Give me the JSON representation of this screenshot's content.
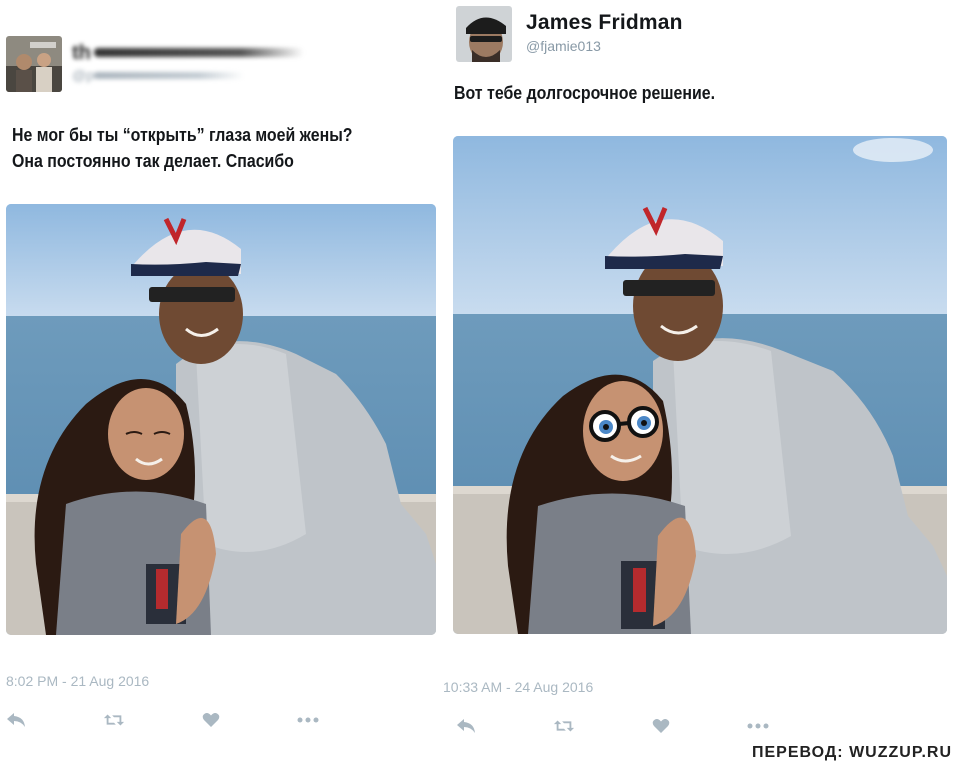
{
  "left_tweet": {
    "author_name": "th",
    "author_handle": "@p",
    "text_line_1": "Не мог бы ты “открыть” глаза моей жены?",
    "text_line_2": "Она постоянно так делает. Спасибо",
    "timestamp": "8:02 PM - 21 Aug 2016",
    "actions": [
      "reply-icon",
      "retweet-icon",
      "like-icon",
      "more-icon"
    ]
  },
  "right_tweet": {
    "author_name": "James Fridman",
    "author_handle": "@fjamie013",
    "text": "Вот тебе долгосрочное решение.",
    "timestamp": "10:33 AM - 24 Aug 2016",
    "actions": [
      "reply-icon",
      "retweet-icon",
      "like-icon",
      "more-icon"
    ]
  },
  "credit": "ПЕРЕВОД: WUZZUP.RU",
  "colors": {
    "icon_gray": "#aab8c2",
    "text": "#14171a",
    "handle": "#8899a6",
    "sky": "#a8c8e6",
    "sea": "#6f9dbd"
  }
}
